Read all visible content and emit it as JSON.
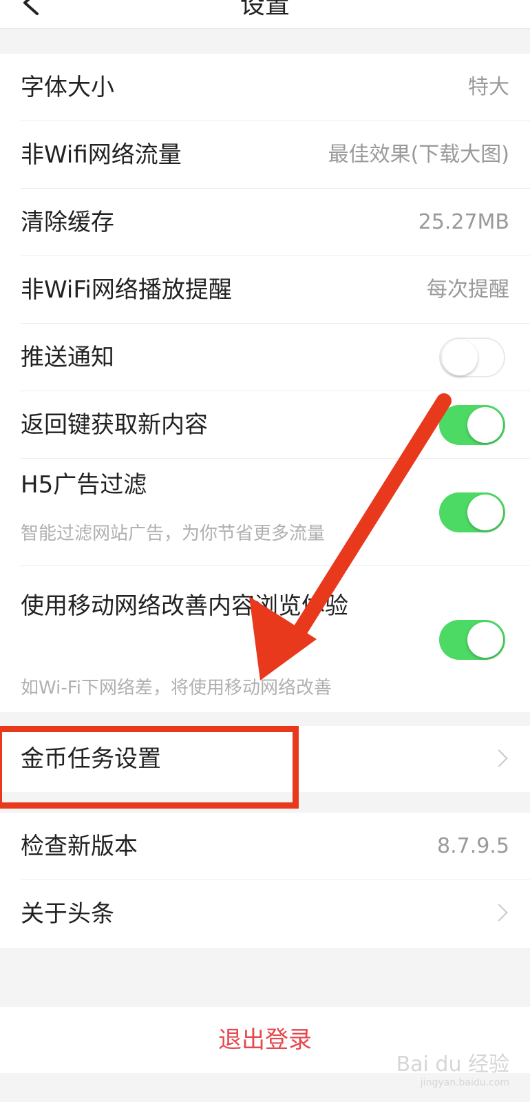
{
  "header": {
    "title": "设置",
    "back_icon": "chevron-left-icon"
  },
  "group1": {
    "font_size": {
      "label": "字体大小",
      "value": "特大"
    },
    "non_wifi_traffic": {
      "label": "非Wifi网络流量",
      "value": "最佳效果(下载大图)"
    },
    "clear_cache": {
      "label": "清除缓存",
      "value": "25.27MB"
    },
    "non_wifi_play_reminder": {
      "label": "非WiFi网络播放提醒",
      "value": "每次提醒"
    },
    "push_notifications": {
      "label": "推送通知",
      "toggle": false
    },
    "back_key_refresh": {
      "label": "返回键获取新内容",
      "toggle": true
    },
    "h5_ad_filter": {
      "label": "H5广告过滤",
      "sub": "智能过滤网站广告，为你节省更多流量",
      "toggle": true
    },
    "mobile_network_improve": {
      "label": "使用移动网络改善内容浏览体验",
      "sub": "如Wi-Fi下网络差，将使用移动网络改善",
      "toggle": true
    }
  },
  "group2": {
    "coin_task_settings": {
      "label": "金币任务设置"
    }
  },
  "group3": {
    "check_version": {
      "label": "检查新版本",
      "value": "8.7.9.5"
    },
    "about": {
      "label": "关于头条"
    }
  },
  "logout": {
    "label": "退出登录"
  },
  "watermark": {
    "text": "Bai du 经验",
    "sub": "jingyan.baidu.com"
  },
  "colors": {
    "toggle_on": "#4cd964",
    "logout": "#e5484d",
    "annotation": "#e8391d"
  }
}
